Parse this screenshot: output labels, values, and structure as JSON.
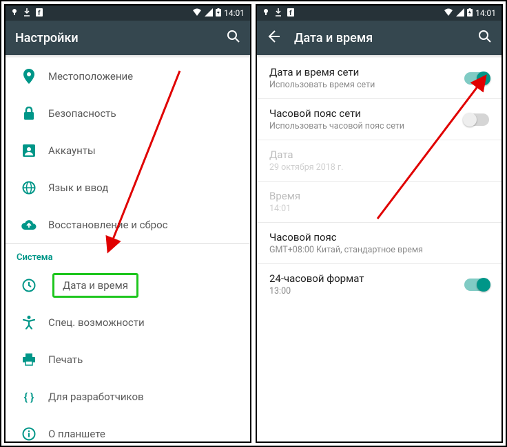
{
  "status": {
    "time": "14:01"
  },
  "left": {
    "title": "Настройки",
    "items": [
      {
        "icon": "location-icon",
        "label": "Местоположение"
      },
      {
        "icon": "lock-icon",
        "label": "Безопасность"
      },
      {
        "icon": "account-icon",
        "label": "Аккаунты"
      },
      {
        "icon": "globe-icon",
        "label": "Язык и ввод"
      },
      {
        "icon": "backup-icon",
        "label": "Восстановление и сброс"
      }
    ],
    "section": "Система",
    "system_items": [
      {
        "icon": "clock-icon",
        "label": "Дата и время",
        "highlight": true
      },
      {
        "icon": "accessibility-icon",
        "label": "Спец. возможности"
      },
      {
        "icon": "print-icon",
        "label": "Печать"
      },
      {
        "icon": "dev-icon",
        "label": "Для разработчиков"
      },
      {
        "icon": "info-icon",
        "label": "О планшете"
      }
    ]
  },
  "right": {
    "title": "Дата и время",
    "settings": [
      {
        "title": "Дата и время сети",
        "sub": "Использовать время сети",
        "toggle": "on"
      },
      {
        "title": "Часовой пояс сети",
        "sub": "Использовать часовой пояс сети",
        "toggle": "off"
      },
      {
        "title": "Дата",
        "sub": "29 октября 2018 г.",
        "disabled": true
      },
      {
        "title": "Время",
        "sub": "14:01",
        "disabled": true
      },
      {
        "title": "Часовой пояс",
        "sub": "GMT+08:00 Китай, стандартное время"
      },
      {
        "title": "24-часовой формат",
        "sub": "13:00",
        "toggle": "on"
      }
    ]
  }
}
